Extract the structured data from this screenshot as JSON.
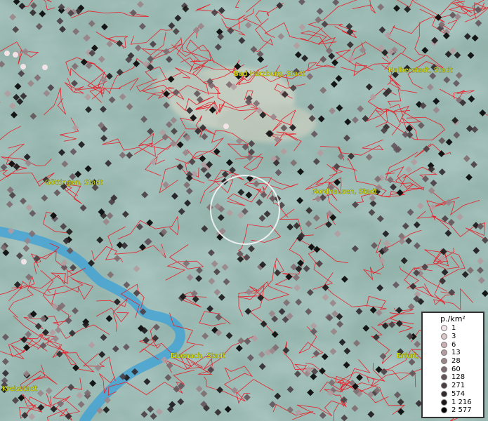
{
  "map": {
    "colors": {
      "boundary": "#e8202a",
      "river": "#3aa0d8",
      "label": "#e8e800"
    },
    "places": [
      {
        "name": "Bad Harzburg, Stadt"
      },
      {
        "name": "Halberstadt, Stadt"
      },
      {
        "name": "Göttingen, Stadt"
      },
      {
        "name": "Nordhausen, Stadt"
      },
      {
        "name": "Eisenach, Stadt"
      },
      {
        "name": "Erfurt,"
      },
      {
        "name": "Kreisstadt"
      }
    ]
  },
  "legend": {
    "title": "p./km²",
    "items": [
      {
        "label": "1",
        "color": "#f2e4e6"
      },
      {
        "label": "3",
        "color": "#dcc6c8"
      },
      {
        "label": "6",
        "color": "#c9b0b3"
      },
      {
        "label": "13",
        "color": "#b39ca0"
      },
      {
        "label": "28",
        "color": "#9a8589"
      },
      {
        "label": "60",
        "color": "#7f6c70"
      },
      {
        "label": "128",
        "color": "#64545a"
      },
      {
        "label": "271",
        "color": "#4a3e42"
      },
      {
        "label": "574",
        "color": "#32292c"
      },
      {
        "label": "1 216",
        "color": "#1c1719"
      },
      {
        "label": "2 577",
        "color": "#050404"
      }
    ]
  }
}
